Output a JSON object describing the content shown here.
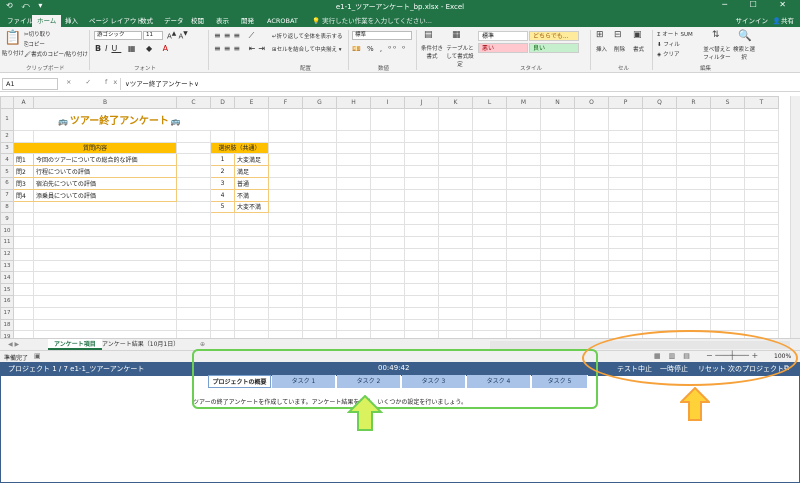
{
  "window": {
    "title": "e1-1_ツアーアンケート_bp.xlsx - Excel",
    "quick_access": "⟲ ⤺ ▾"
  },
  "ribbon_tabs": [
    "ファイル",
    "ホーム",
    "挿入",
    "ページ レイアウト",
    "数式",
    "データ",
    "校閲",
    "表示",
    "開発",
    "ACROBAT"
  ],
  "tell_me": "実行したい作業を入力してください...",
  "account": {
    "signin": "サインイン",
    "share": "共有"
  },
  "ribbon": {
    "paste": "貼り付け",
    "cut": "切り取り",
    "copy": "コピー",
    "format_painter": "書式のコピー/貼り付け",
    "clipboard": "クリップボード",
    "font_name": "游ゴシック",
    "font_size": "11",
    "font": "フォント",
    "wrap_text": "折り返して全体を表示する",
    "merge_center": "セルを結合して中央揃え",
    "alignment": "配置",
    "number_format": "標準",
    "number": "数値",
    "conditional": "条件付き書式",
    "format_table": "テーブルとして書式設定",
    "style_normal": "標準",
    "style_neutral": "どちらでも...",
    "style_bad": "悪い",
    "style_good": "良い",
    "styles": "スタイル",
    "insert": "挿入",
    "delete": "削除",
    "format": "書式",
    "cells": "セル",
    "autosum": "オート SUM",
    "fill": "フィル",
    "clear": "クリア",
    "sort_filter": "並べ替えとフィルター",
    "find_select": "検索と選択",
    "editing": "編集"
  },
  "formula_bar": {
    "cell": "A1",
    "fx": "× ✓ fx",
    "value": "∨ツアー終了アンケート∨"
  },
  "columns": [
    "A",
    "B",
    "C",
    "D",
    "E",
    "F",
    "G",
    "H",
    "I",
    "J",
    "K",
    "L",
    "M",
    "N",
    "O",
    "P",
    "Q",
    "R",
    "S",
    "T"
  ],
  "sheet": {
    "title": "ツアー終了アンケート",
    "bus_icon": "🚌",
    "question_header": "質問内容",
    "choice_header": "選択肢（共通）",
    "questions": [
      {
        "no": "問1",
        "text": "今回のツアーについての総合的な評価"
      },
      {
        "no": "問2",
        "text": "行程についての評価"
      },
      {
        "no": "問3",
        "text": "宿泊先についての評価"
      },
      {
        "no": "問4",
        "text": "添乗員についての評価"
      }
    ],
    "choices": [
      {
        "no": "1",
        "text": "大変満足"
      },
      {
        "no": "2",
        "text": "満足"
      },
      {
        "no": "3",
        "text": "普通"
      },
      {
        "no": "4",
        "text": "不満"
      },
      {
        "no": "5",
        "text": "大変不満"
      }
    ]
  },
  "sheet_tabs": [
    "アンケート項目",
    "アンケート結果（10月1日）"
  ],
  "status": {
    "ready": "準備完了",
    "zoom": "100%"
  },
  "task": {
    "project": "プロジェクト 1 / 7   e1-1_ツアーアンケート",
    "timer": "00:49:42",
    "buttons": [
      "テスト中止",
      "一時停止",
      "リセット",
      "次のプロジェクト"
    ],
    "tabs": [
      "プロジェクトの概要",
      "タスク 1",
      "タスク 2",
      "タスク 3",
      "タスク 4",
      "タスク 5"
    ],
    "description": "ツアーの終了アンケートを作成しています。アンケート結果を集計、いくつかの設定を行いましょう。"
  }
}
